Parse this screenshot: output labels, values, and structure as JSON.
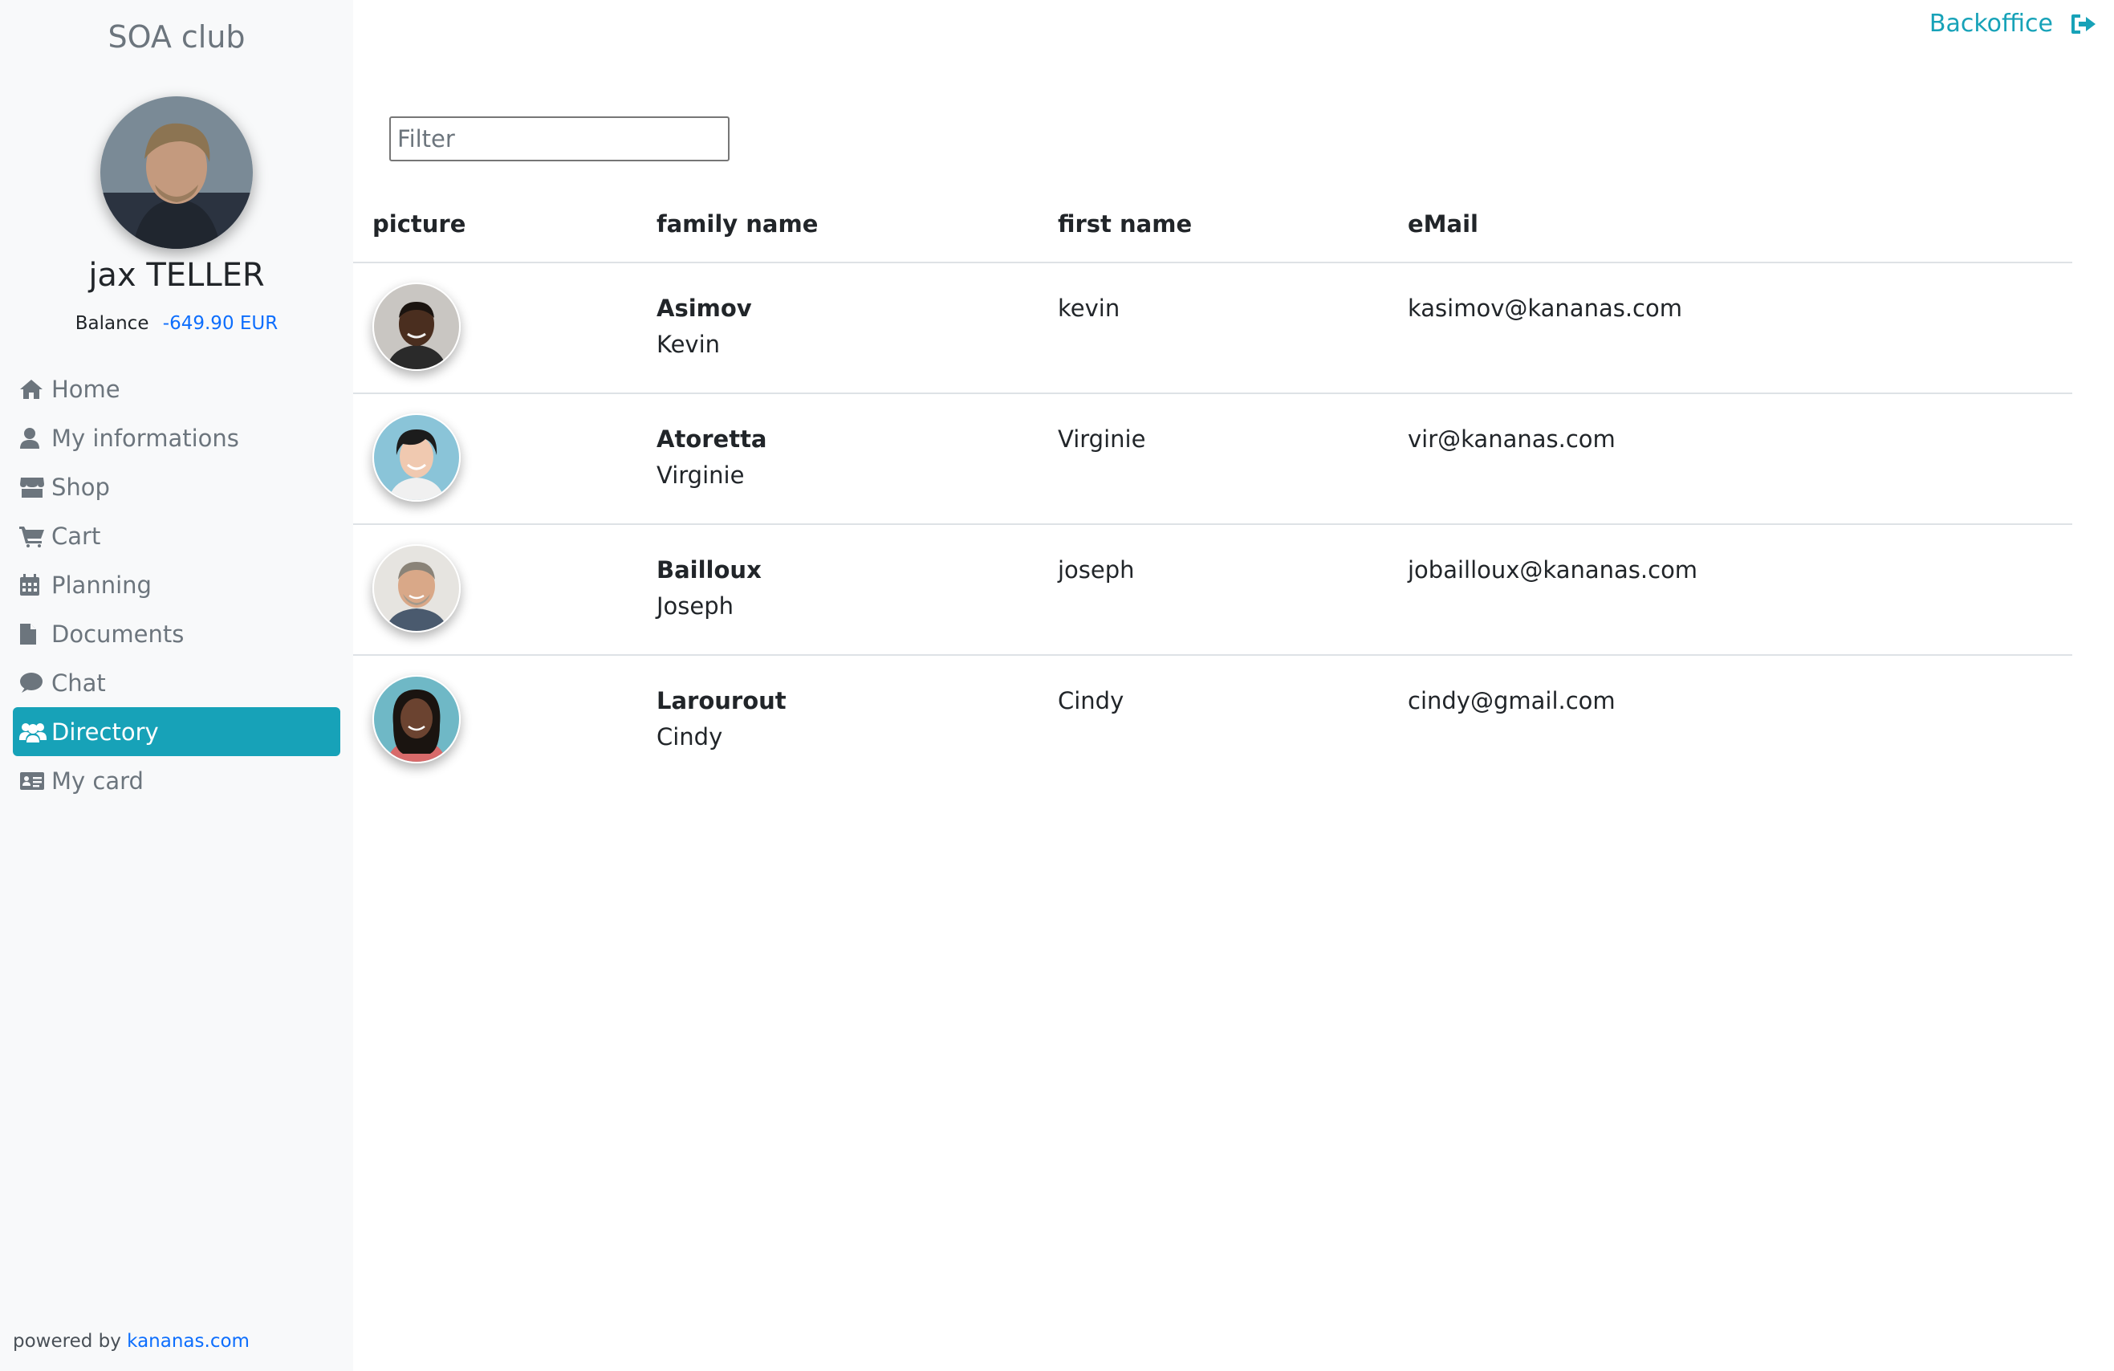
{
  "sidebar": {
    "club_name": "SOA club",
    "profile_name": "jax TELLER",
    "balance_label": "Balance",
    "balance_amount": "-649.90 EUR",
    "nav": [
      {
        "label": "Home",
        "icon": "home-icon"
      },
      {
        "label": "My informations",
        "icon": "user-icon"
      },
      {
        "label": "Shop",
        "icon": "store-icon"
      },
      {
        "label": "Cart",
        "icon": "cart-icon"
      },
      {
        "label": "Planning",
        "icon": "calendar-icon"
      },
      {
        "label": "Documents",
        "icon": "document-icon"
      },
      {
        "label": "Chat",
        "icon": "chat-icon"
      },
      {
        "label": "Directory",
        "icon": "users-icon",
        "active": true
      },
      {
        "label": "My card",
        "icon": "id-card-icon"
      }
    ],
    "powered_by": "powered by",
    "powered_link": "kananas.com"
  },
  "header": {
    "backoffice_label": "Backoffice",
    "backoffice_icon": "sign-out-icon"
  },
  "filter": {
    "placeholder": "Filter",
    "value": ""
  },
  "table": {
    "columns": [
      "picture",
      "family name",
      "first name",
      "eMail"
    ],
    "rows": [
      {
        "family": "Asimov",
        "given": "Kevin",
        "first_name": "kevin",
        "email": "kasimov@kananas.com"
      },
      {
        "family": "Atoretta",
        "given": "Virginie",
        "first_name": "Virginie",
        "email": "vir@kananas.com"
      },
      {
        "family": "Bailloux",
        "given": "Joseph",
        "first_name": "joseph",
        "email": "jobailloux@kananas.com"
      },
      {
        "family": "Larourout",
        "given": "Cindy",
        "first_name": "Cindy",
        "email": "cindy@gmail.com"
      }
    ]
  },
  "colors": {
    "accent": "#17a2b8",
    "link": "#0d6efd",
    "sidebar_bg": "#f8f9fa"
  }
}
